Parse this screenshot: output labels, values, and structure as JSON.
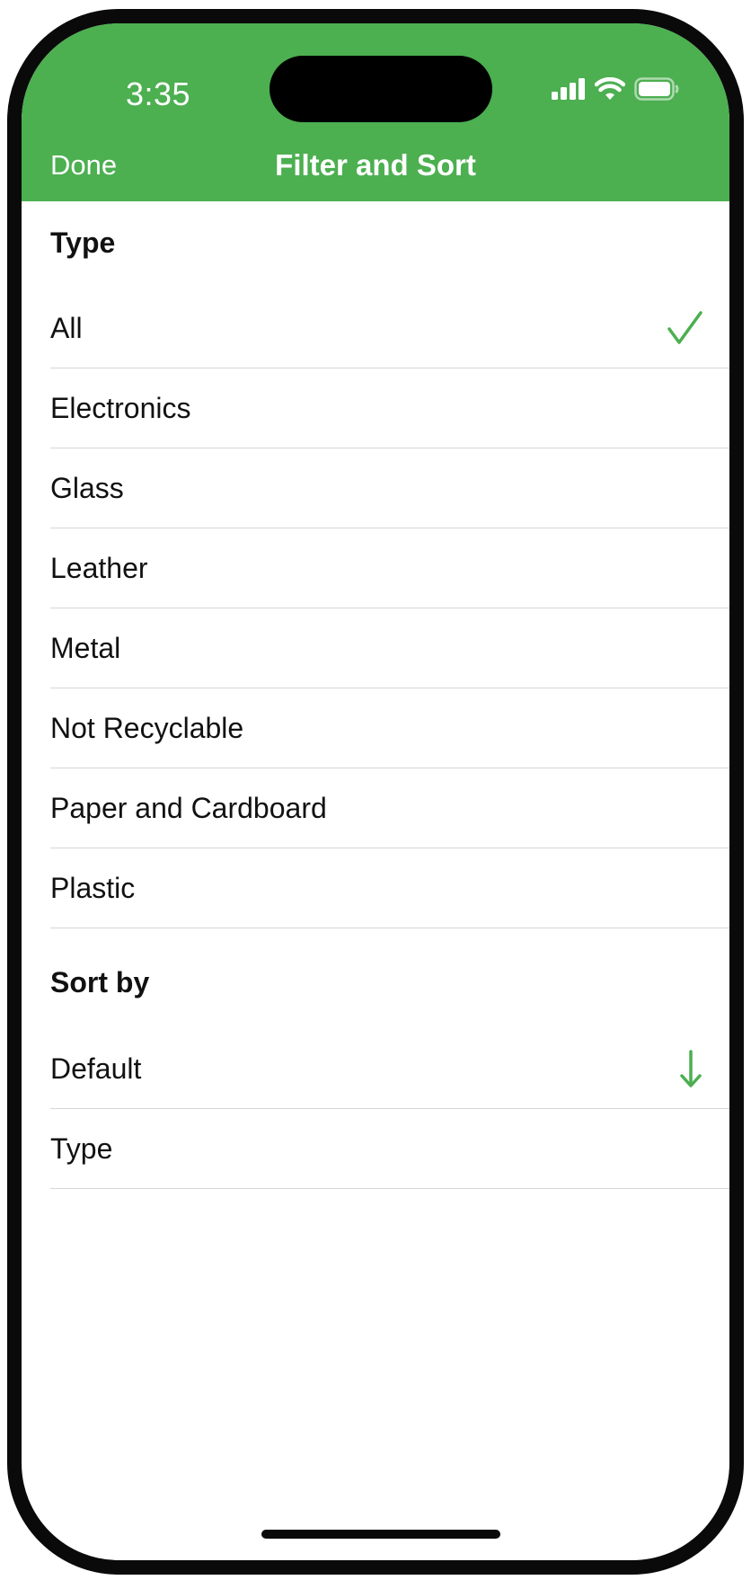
{
  "status_bar": {
    "time": "3:35",
    "icons": [
      "cellular-signal-icon",
      "wifi-icon",
      "battery-icon"
    ]
  },
  "nav": {
    "done_label": "Done",
    "title": "Filter and Sort"
  },
  "type_section": {
    "header": "Type",
    "items": [
      {
        "label": "All",
        "selected": true
      },
      {
        "label": "Electronics",
        "selected": false
      },
      {
        "label": "Glass",
        "selected": false
      },
      {
        "label": "Leather",
        "selected": false
      },
      {
        "label": "Metal",
        "selected": false
      },
      {
        "label": "Not Recyclable",
        "selected": false
      },
      {
        "label": "Paper and Cardboard",
        "selected": false
      },
      {
        "label": "Plastic",
        "selected": false
      }
    ]
  },
  "sort_section": {
    "header": "Sort by",
    "items": [
      {
        "label": "Default",
        "selected": true,
        "direction": "descending"
      },
      {
        "label": "Type",
        "selected": false
      }
    ]
  },
  "colors": {
    "accent": "#4caf50",
    "header_text": "#ffffff",
    "text": "#111111",
    "separator": "#d6d6d6",
    "frame": "#0a0a0a"
  }
}
